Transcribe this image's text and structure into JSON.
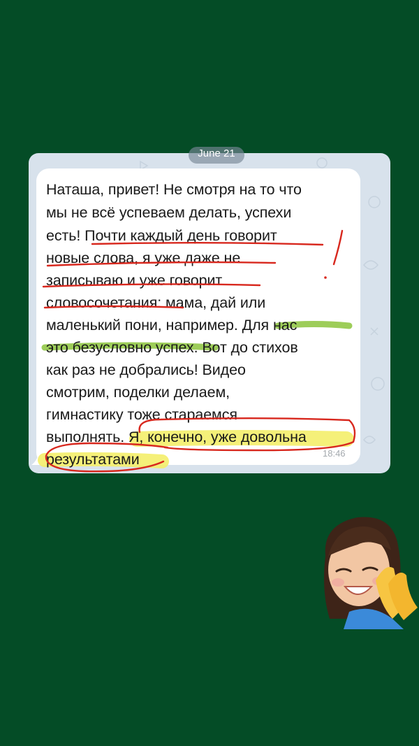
{
  "chat": {
    "date_label": "June 21",
    "time": "18:46",
    "message_lines": [
      "Наташа, привет! Не смотря на то что",
      "мы не всё успеваем делать, успехи",
      "есть! Почти каждый день говорит",
      "новые слова, я уже даже не",
      "записываю и уже говорит",
      "словосочетания: мама, дай или",
      "маленький пони, например. Для нас",
      "это безусловно успех. Вот до стихов",
      "как раз не добрались! Видео",
      "смотрим, поделки делаем,",
      "гимнастику тоже стараемся",
      "выполнять. Я, конечно, уже довольна",
      "результатами"
    ]
  },
  "colors": {
    "background": "#044c26",
    "chat_background": "#d8e2ec",
    "bubble": "#ffffff",
    "red_marker": "#d8281e",
    "green_marker": "#8cc43c",
    "yellow_marker": "#f4ee6a"
  },
  "icons": [
    "memoji-praying-hands-icon"
  ]
}
